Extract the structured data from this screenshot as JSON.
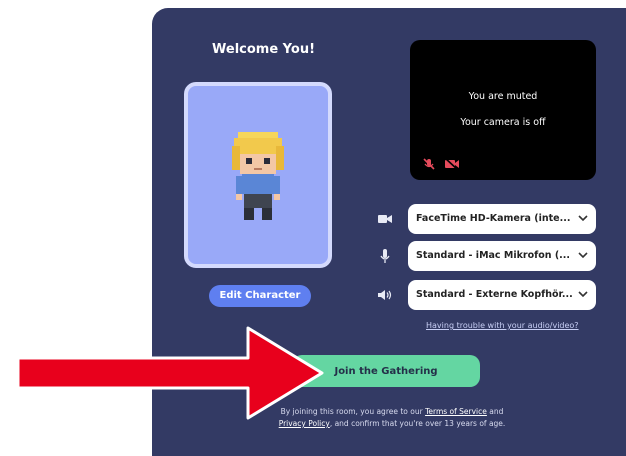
{
  "welcome": {
    "title": "Welcome You!"
  },
  "avatar": {
    "edit_label": "Edit Character"
  },
  "preview": {
    "muted_text": "You are muted",
    "camera_off_text": "Your camera is off"
  },
  "devices": {
    "camera": "FaceTime HD-Kamera (inte...",
    "microphone": "Standard - iMac Mikrofon (...",
    "speaker": "Standard - Externe Kopfhör..."
  },
  "trouble_link": "Having trouble with your audio/video?",
  "join_label": "Join the Gathering",
  "legal": {
    "prefix": "By joining this room, you agree to our",
    "tos": "Terms of Service",
    "and": "and",
    "privacy": "Privacy Policy",
    "suffix": ", and confirm that you're over 13 years of age."
  },
  "colors": {
    "panel": "#333a64",
    "join": "#64d6a2",
    "edit": "#5f7ff0",
    "arrow": "#e8001c",
    "mute_icon": "#e54b5c"
  }
}
